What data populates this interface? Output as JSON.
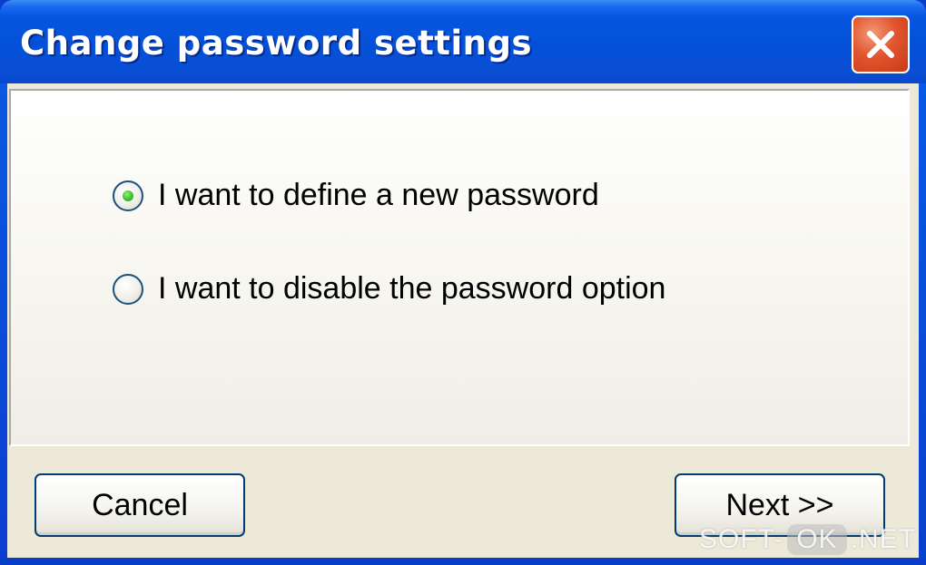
{
  "window": {
    "title": "Change password settings",
    "close_icon": "close-x-icon"
  },
  "options": [
    {
      "label": "I want to define a new password",
      "selected": true
    },
    {
      "label": "I want to disable the password option",
      "selected": false
    }
  ],
  "buttons": {
    "cancel_label": "Cancel",
    "next_label": "Next >>"
  },
  "watermark": {
    "part1": "SOFT-",
    "part2": "OK",
    "part3": ".NET"
  },
  "colors": {
    "titlebar": "#0450d8",
    "close_button": "#e1552e",
    "dialog_background": "#ece9d8",
    "radio_selected": "#3fbf2a"
  }
}
